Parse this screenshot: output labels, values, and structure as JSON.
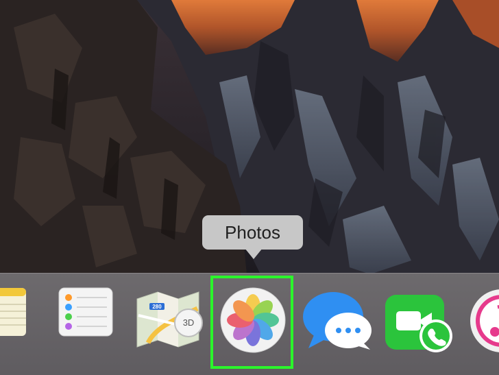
{
  "tooltip": {
    "label": "Photos"
  },
  "dock": {
    "items": [
      {
        "name": "notes",
        "icon": "notes-icon"
      },
      {
        "name": "reminders",
        "icon": "reminders-icon"
      },
      {
        "name": "maps",
        "icon": "maps-icon",
        "route_number": "280",
        "view_mode": "3D"
      },
      {
        "name": "photos",
        "icon": "photos-icon",
        "highlighted": true
      },
      {
        "name": "messages",
        "icon": "messages-icon"
      },
      {
        "name": "facetime",
        "icon": "facetime-icon"
      },
      {
        "name": "itunes",
        "icon": "itunes-icon"
      }
    ]
  },
  "colors": {
    "highlight": "#2bf52b",
    "dock_background": "#656265",
    "tooltip_background": "#c7c7c7"
  }
}
